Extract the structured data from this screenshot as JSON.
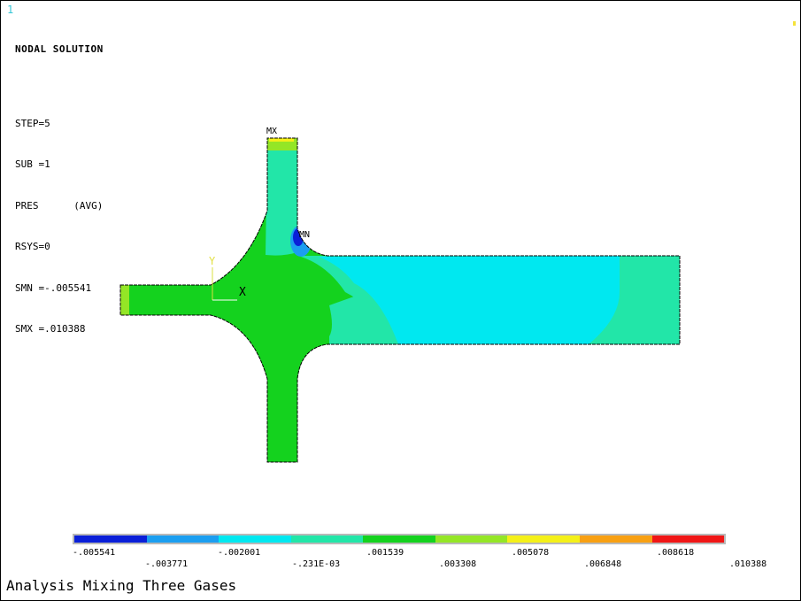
{
  "window": {
    "number": "1"
  },
  "info": {
    "title": "NODAL SOLUTION",
    "lines": [
      "STEP=5",
      "SUB =1",
      "PRES      (AVG)",
      "RSYS=0",
      "SMN =-.005541",
      "SMX =.010388"
    ]
  },
  "plot": {
    "max_label": "MX",
    "min_label": "MN",
    "axis_y_label": "Y",
    "axis_x_label": "X"
  },
  "legend": {
    "colors": [
      "#0a1fd8",
      "#1b9ef0",
      "#00e8f0",
      "#22e6a8",
      "#14d21e",
      "#94e626",
      "#f4f018",
      "#f8a012",
      "#f01616"
    ],
    "ticks_top": [
      "-.005541",
      "-.002001",
      ".001539",
      ".005078",
      ".008618"
    ],
    "ticks_bottom": [
      "-.003771",
      "-.231E-03",
      ".003308",
      ".006848",
      ".010388"
    ]
  },
  "caption": "Analysis Mixing Three Gases"
}
